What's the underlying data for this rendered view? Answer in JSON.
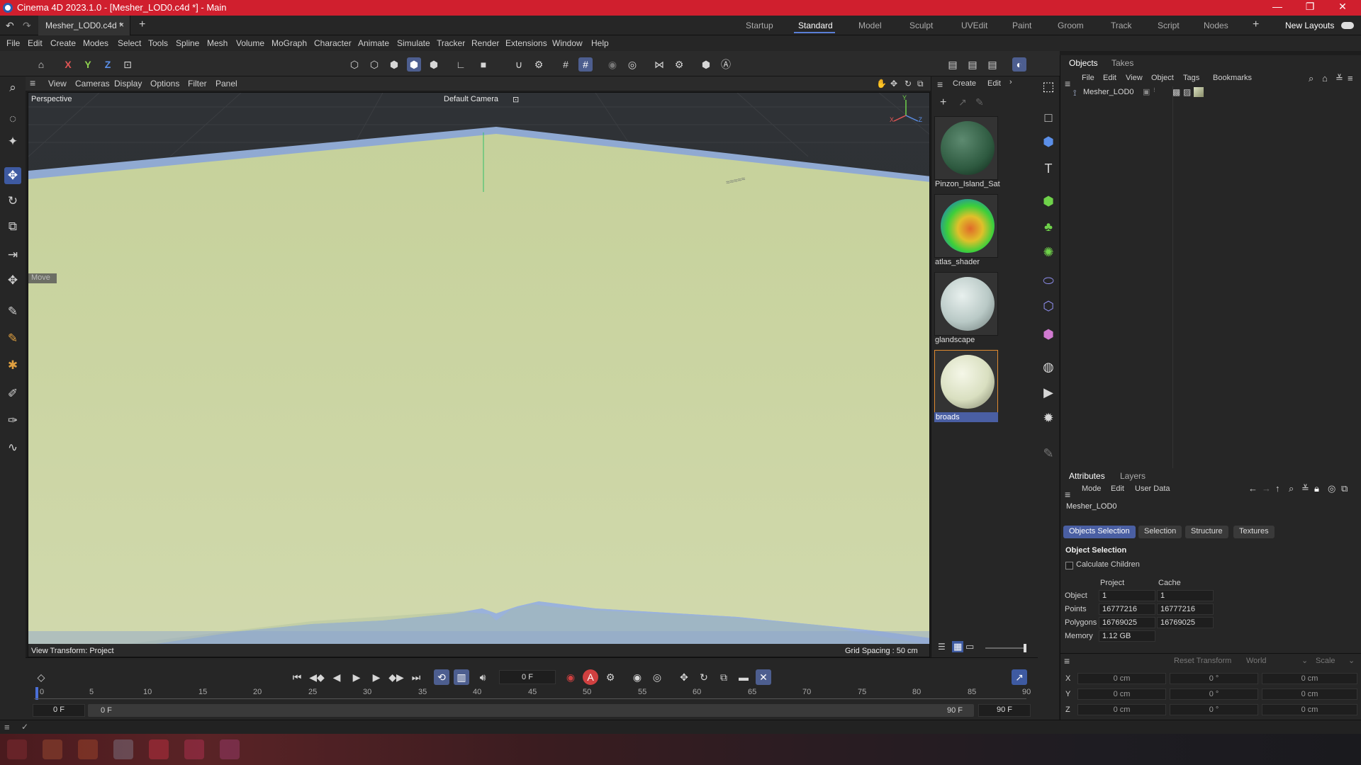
{
  "window": {
    "title": "Cinema 4D 2023.1.0 - [Mesher_LOD0.c4d *] - Main",
    "minimize": "—",
    "maximize": "❐",
    "close": "✕"
  },
  "doc_tab": {
    "label": "Mesher_LOD0.c4d *",
    "close": "×",
    "add": "+"
  },
  "layouts": [
    "Startup",
    "Standard",
    "Model",
    "Sculpt",
    "UVEdit",
    "Paint",
    "Groom",
    "Track",
    "Script",
    "Nodes"
  ],
  "layout_active": "Standard",
  "new_layouts": "New Layouts",
  "menu": [
    "File",
    "Edit",
    "Create",
    "Modes",
    "Select",
    "Tools",
    "Spline",
    "Mesh",
    "Volume",
    "MoGraph",
    "Character",
    "Animate",
    "Simulate",
    "Tracker",
    "Render",
    "Extensions",
    "Window",
    "Help"
  ],
  "toolbar": {
    "x": "X",
    "y": "Y",
    "z": "Z"
  },
  "viewport": {
    "menus": [
      "View",
      "Cameras",
      "Display",
      "Options",
      "Filter",
      "Panel"
    ],
    "projection": "Perspective",
    "camera": "Default Camera",
    "tool_label": "Move",
    "view_transform": "View Transform: Project",
    "grid_spacing": "Grid Spacing : 50 cm",
    "axis_x": "X",
    "axis_y": "Y",
    "axis_z": "Z"
  },
  "materials": {
    "menus": [
      "Create",
      "Edit"
    ],
    "items": [
      {
        "name": "Pinzon_Island_Sat",
        "color": "#2e5a40"
      },
      {
        "name": "atlas_shader",
        "color": "#3ccf3a"
      },
      {
        "name": "glandscape",
        "color": "#b9c9c6"
      },
      {
        "name": "broads",
        "color": "#d9dfc0"
      }
    ]
  },
  "objects_panel": {
    "tabs": [
      "Objects",
      "Takes"
    ],
    "menus": [
      "File",
      "Edit",
      "View",
      "Object",
      "Tags",
      "Bookmarks"
    ],
    "object_name": "Mesher_LOD0"
  },
  "attributes_panel": {
    "tabs": [
      "Attributes",
      "Layers"
    ],
    "menus": [
      "Mode",
      "Edit",
      "User Data"
    ],
    "object_name": "Mesher_LOD0",
    "subtabs": [
      "Objects Selection",
      "Selection",
      "Structure",
      "Textures"
    ],
    "section": "Object Selection",
    "checkbox": "Calculate Children",
    "col_project": "Project",
    "col_cache": "Cache",
    "rows": [
      {
        "label": "Object",
        "project": "1",
        "cache": "1"
      },
      {
        "label": "Points",
        "project": "16777216",
        "cache": "16777216"
      },
      {
        "label": "Polygons",
        "project": "16769025",
        "cache": "16769025"
      },
      {
        "label": "Memory",
        "project": "1.12 GB",
        "cache": ""
      }
    ]
  },
  "coords": {
    "reset": "Reset Transform",
    "world": "World",
    "scale": "Scale",
    "rows": [
      {
        "axis": "X",
        "pos": "0 cm",
        "rot": "0 °",
        "size": "0 cm"
      },
      {
        "axis": "Y",
        "pos": "0 cm",
        "rot": "0 °",
        "size": "0 cm"
      },
      {
        "axis": "Z",
        "pos": "0 cm",
        "rot": "0 °",
        "size": "0 cm"
      }
    ]
  },
  "timeline": {
    "current_frame": "0 F",
    "start": "0 F",
    "range_start": "0 F",
    "range_end": "90 F",
    "end": "90 F",
    "ruler": [
      "0",
      "5",
      "10",
      "15",
      "20",
      "25",
      "30",
      "35",
      "40",
      "45",
      "50",
      "55",
      "60",
      "65",
      "70",
      "75",
      "80",
      "85",
      "90"
    ],
    "key_a": "A"
  }
}
